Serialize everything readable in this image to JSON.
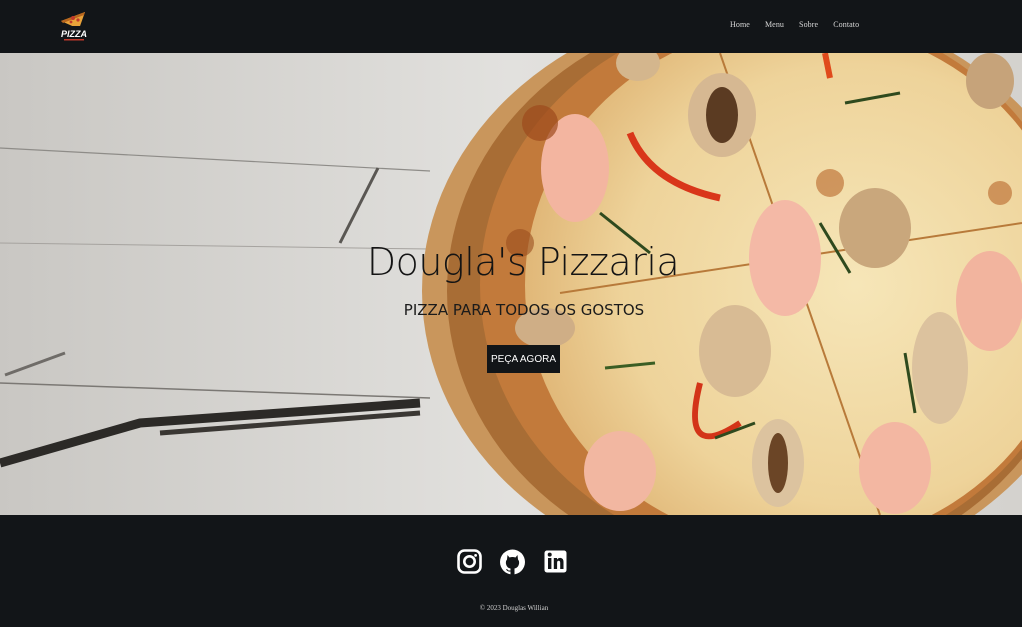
{
  "brand": {
    "logo_text": "PIZZA"
  },
  "nav": {
    "items": [
      {
        "label": "Home"
      },
      {
        "label": "Menu"
      },
      {
        "label": "Sobre"
      },
      {
        "label": "Contato"
      }
    ]
  },
  "hero": {
    "title": "Dougla's Pizzaria",
    "subtitle": "PIZZA PARA TODOS OS GOSTOS",
    "cta_label": "PEÇA AGORA"
  },
  "footer": {
    "social": [
      {
        "icon": "instagram-icon"
      },
      {
        "icon": "github-icon"
      },
      {
        "icon": "linkedin-icon"
      }
    ],
    "copyright": "© 2023 Douglas Willian"
  },
  "colors": {
    "dark": "#121518",
    "wood": "#d9d7d3",
    "crust": "#c98b46",
    "cheese": "#f1dfae"
  }
}
